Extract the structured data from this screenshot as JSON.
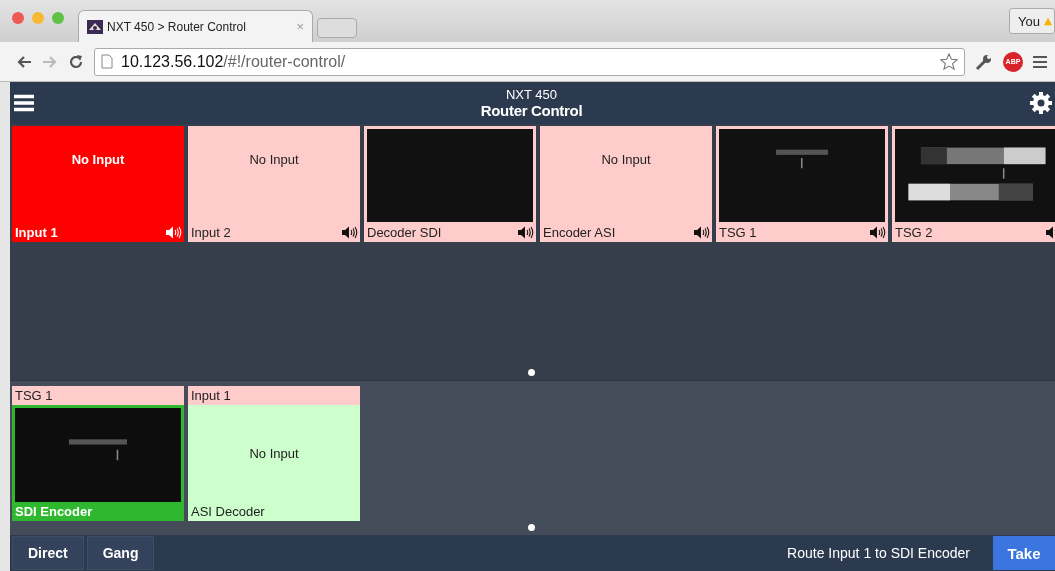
{
  "browser": {
    "tab_title": "NXT 450 > Router Control",
    "tab_close": "×",
    "url_host": "10.123.56.102",
    "url_path": "/#!/router-control/",
    "profile": "You",
    "extension": "ABP"
  },
  "header": {
    "subtitle": "NXT 450",
    "title": "Router Control"
  },
  "sources": [
    {
      "label": "Input 1",
      "kind": "none",
      "message": "No Input",
      "selected": true
    },
    {
      "label": "Input 2",
      "kind": "none",
      "message": "No Input",
      "selected": false
    },
    {
      "label": "Decoder SDI",
      "kind": "black",
      "selected": false
    },
    {
      "label": "Encoder ASI",
      "kind": "none",
      "message": "No Input",
      "selected": false
    },
    {
      "label": "TSG 1",
      "kind": "picture",
      "selected": false
    },
    {
      "label": "TSG 2",
      "kind": "bars",
      "selected": false
    }
  ],
  "destinations": [
    {
      "source": "TSG 1",
      "label": "SDI Encoder",
      "kind": "picture",
      "selected": true
    },
    {
      "source": "Input 1",
      "label": "ASI Decoder",
      "kind": "none",
      "message": "No Input",
      "selected": false
    }
  ],
  "footer": {
    "buttons": [
      "Direct",
      "Gang"
    ],
    "status": "Route Input 1 to SDI Encoder",
    "action": "Take"
  }
}
